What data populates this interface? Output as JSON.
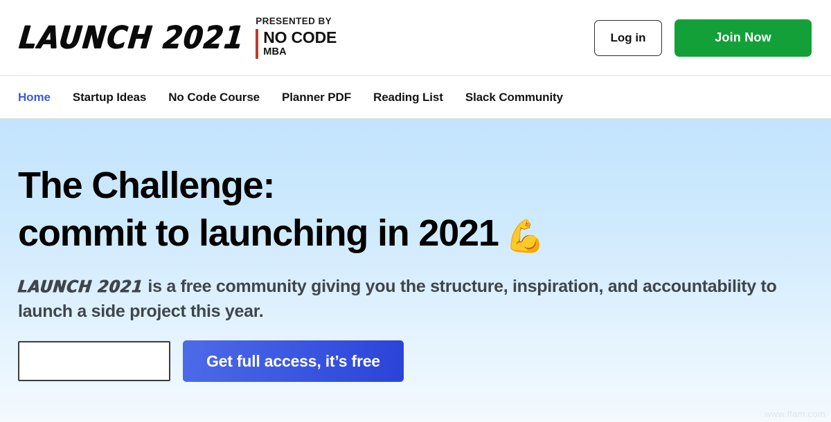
{
  "header": {
    "logo_wordmark": "Launch 2021",
    "presented_by_label": "PRESENTED BY",
    "partner_name": "NO CODE",
    "partner_sub": "MBA",
    "accent_bar_color": "#c0392b",
    "login_label": "Log in",
    "join_label": "Join Now",
    "join_color": "#14a038"
  },
  "nav": {
    "active_color": "#3b5bd9",
    "items": [
      {
        "label": "Home",
        "active": true
      },
      {
        "label": "Startup Ideas",
        "active": false
      },
      {
        "label": "No Code Course",
        "active": false
      },
      {
        "label": "Planner PDF",
        "active": false
      },
      {
        "label": "Reading List",
        "active": false
      },
      {
        "label": "Slack Community",
        "active": false
      }
    ]
  },
  "hero": {
    "title_line1": "The Challenge:",
    "title_line2": "commit to launching in 2021",
    "title_emoji": "💪",
    "emoji_name": "flexed-biceps-emoji",
    "sub_logo": "Launch 2021",
    "sub_text": " is a free community giving you the structure, inspiration, and accountability to launch a side project this year.",
    "bg_top_color": "#c2e4fd",
    "bg_bottom_color": "#f4fafe"
  },
  "signup": {
    "email_value": "",
    "email_placeholder": "",
    "cta_label": "Get full access, it’s free",
    "cta_color_from": "#4d6be8",
    "cta_color_to": "#2b43d8"
  },
  "watermark": {
    "text": "www.ffam.com"
  }
}
